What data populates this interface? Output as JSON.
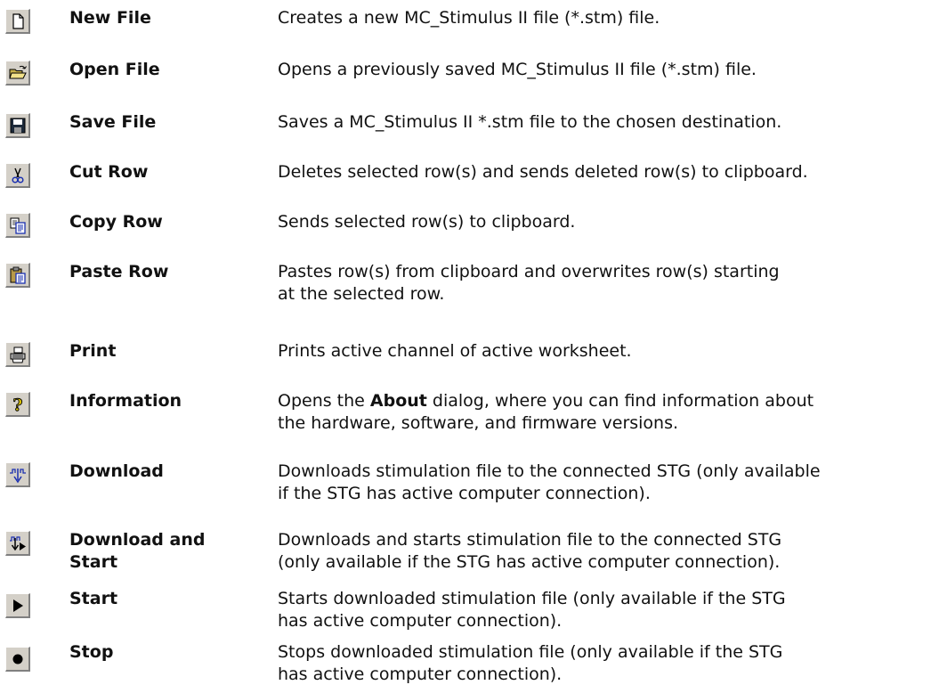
{
  "commands": [
    {
      "icon": "new-file-icon",
      "name": "New File",
      "desc": [
        "Creates a new MC_Stimulus II file (*.stm) file."
      ]
    },
    {
      "icon": "open-folder-icon",
      "name": "Open File",
      "desc": [
        "Opens a previously saved MC_Stimulus II file (*.stm) file."
      ]
    },
    {
      "icon": "floppy-disk-icon",
      "name": "Save File",
      "desc": [
        "Saves a MC_Stimulus II *.stm file to the chosen destination."
      ]
    },
    {
      "icon": "scissors-icon",
      "name": "Cut Row",
      "desc": [
        "Deletes selected row(s) and sends deleted row(s) to clipboard."
      ]
    },
    {
      "icon": "copy-icon",
      "name": "Copy Row",
      "desc": [
        "Sends selected row(s) to clipboard."
      ]
    },
    {
      "icon": "paste-icon",
      "name": "Paste Row",
      "desc": [
        "Pastes row(s) from clipboard and overwrites row(s) starting",
        "at the selected row."
      ]
    },
    {
      "icon": "printer-icon",
      "name": "Print",
      "desc": [
        "Prints active channel of active worksheet."
      ]
    },
    {
      "icon": "question-mark-icon",
      "name": "Information",
      "desc": [
        "Opens the ",
        "About",
        " dialog, where you can find information about",
        "the hardware, software, and firmware versions."
      ]
    },
    {
      "icon": "download-icon",
      "name": "Download",
      "desc": [
        "Downloads stimulation file to the connected STG (only available",
        "if the STG has active computer connection)."
      ]
    },
    {
      "icon": "download-start-icon",
      "name": "Download and",
      "name2": "Start",
      "desc": [
        "Downloads and starts stimulation file to the connected STG",
        "(only available if the STG has active computer connection)."
      ]
    },
    {
      "icon": "play-icon",
      "name": "Start",
      "desc": [
        "Starts downloaded stimulation file (only available if the STG",
        "has active computer connection)."
      ]
    },
    {
      "icon": "stop-icon",
      "name": "Stop",
      "desc": [
        "Stops downloaded stimulation file (only available if the STG",
        "has active computer connection)."
      ]
    }
  ]
}
